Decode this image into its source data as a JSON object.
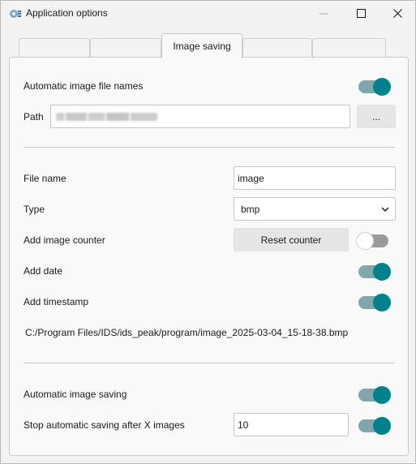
{
  "window": {
    "title": "Application options",
    "icons": {
      "app": "app-gear-icon",
      "minimize": "minimize-icon",
      "maximize": "maximize-icon",
      "close": "close-icon"
    }
  },
  "tabs": [
    {
      "label": "",
      "active": false
    },
    {
      "label": "",
      "active": false
    },
    {
      "label": "Image saving",
      "active": true
    },
    {
      "label": "",
      "active": false
    },
    {
      "label": "",
      "active": false
    }
  ],
  "image_saving": {
    "auto_file_names": {
      "label": "Automatic image file names",
      "enabled": true
    },
    "path": {
      "label": "Path",
      "value": "C:/Users/.../Pictures",
      "browse_label": "..."
    },
    "file_name": {
      "label": "File name",
      "value": "image"
    },
    "type": {
      "label": "Type",
      "value": "bmp",
      "chevron_icon": "chevron-down-icon"
    },
    "image_counter": {
      "label": "Add image counter",
      "enabled": false,
      "reset_label": "Reset counter"
    },
    "add_date": {
      "label": "Add date",
      "enabled": true
    },
    "add_timestamp": {
      "label": "Add timestamp",
      "enabled": true
    },
    "preview_path": "C:/Program Files/IDS/ids_peak/program/image_2025-03-04_15-18-38.bmp",
    "auto_saving": {
      "label": "Automatic image saving",
      "enabled": true
    },
    "stop_after": {
      "label": "Stop automatic saving after X images",
      "value": "10",
      "enabled": true
    }
  },
  "colors": {
    "accent": "#00828c",
    "track_on": "#7fa7ac",
    "track_off": "#9a9a9a"
  }
}
